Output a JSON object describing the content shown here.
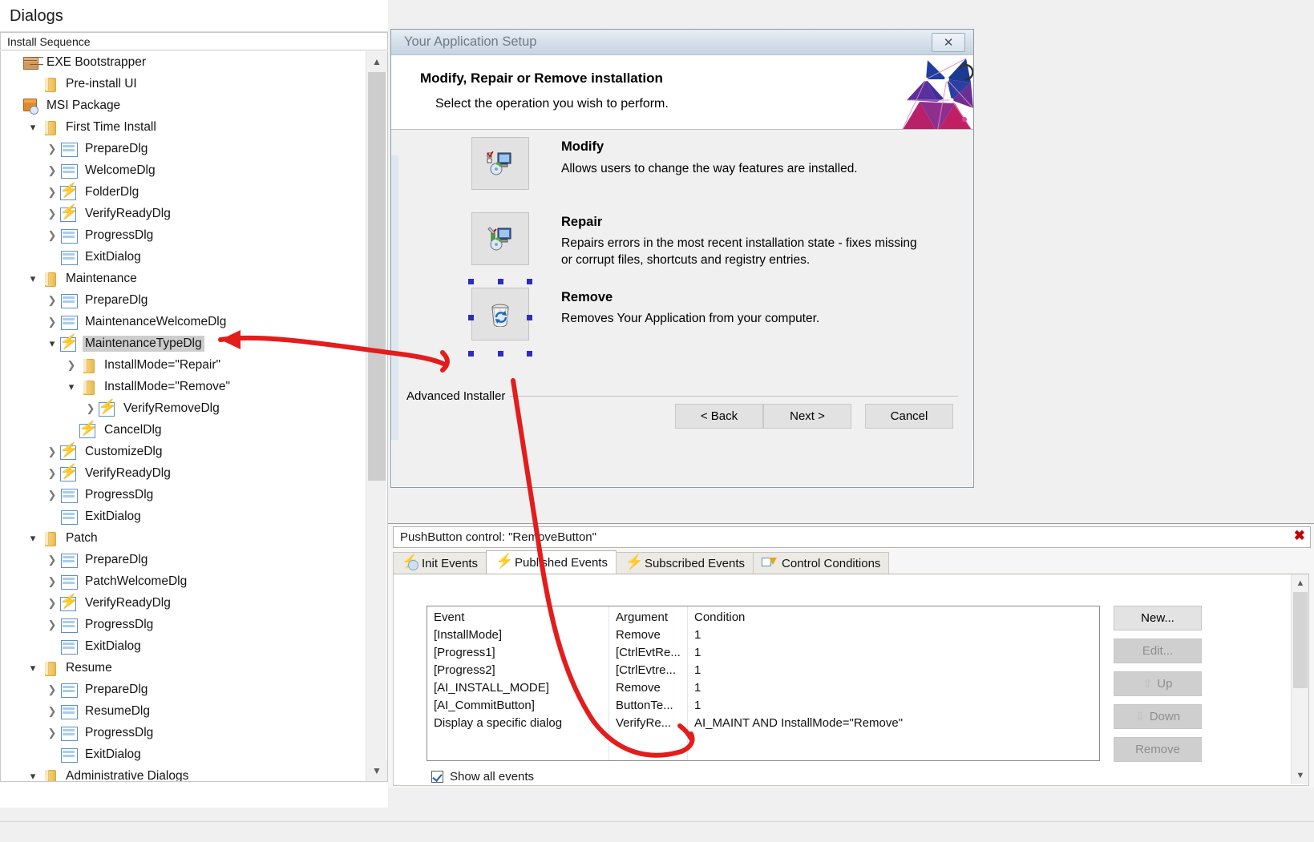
{
  "left_panel": {
    "title": "Dialogs",
    "column_header": "Install Sequence",
    "tree": [
      {
        "label": "EXE Bootstrapper",
        "indent": 0,
        "icon": "exe-package-icon",
        "chevron": "none",
        "selected": false
      },
      {
        "label": "Pre-install UI",
        "indent": 1,
        "icon": "folder-icon",
        "chevron": "none",
        "selected": false
      },
      {
        "label": "MSI Package",
        "indent": 0,
        "icon": "msi-package-icon",
        "chevron": "none",
        "selected": false
      },
      {
        "label": "First Time Install",
        "indent": 1,
        "icon": "folder-icon",
        "chevron": "down",
        "selected": false
      },
      {
        "label": "PrepareDlg",
        "indent": 2,
        "icon": "dialog-icon",
        "chevron": "right",
        "selected": false
      },
      {
        "label": "WelcomeDlg",
        "indent": 2,
        "icon": "dialog-icon",
        "chevron": "right",
        "selected": false
      },
      {
        "label": "FolderDlg",
        "indent": 2,
        "icon": "dialog-event-icon",
        "chevron": "right",
        "selected": false
      },
      {
        "label": "VerifyReadyDlg",
        "indent": 2,
        "icon": "dialog-event-icon",
        "chevron": "right",
        "selected": false
      },
      {
        "label": "ProgressDlg",
        "indent": 2,
        "icon": "dialog-icon",
        "chevron": "right",
        "selected": false
      },
      {
        "label": "ExitDialog",
        "indent": 2,
        "icon": "dialog-icon",
        "chevron": "none",
        "selected": false
      },
      {
        "label": "Maintenance",
        "indent": 1,
        "icon": "folder-icon",
        "chevron": "down",
        "selected": false
      },
      {
        "label": "PrepareDlg",
        "indent": 2,
        "icon": "dialog-icon",
        "chevron": "right",
        "selected": false
      },
      {
        "label": "MaintenanceWelcomeDlg",
        "indent": 2,
        "icon": "dialog-icon",
        "chevron": "right",
        "selected": false
      },
      {
        "label": "MaintenanceTypeDlg",
        "indent": 2,
        "icon": "dialog-event-icon",
        "chevron": "down",
        "selected": true
      },
      {
        "label": "InstallMode=\"Repair\"",
        "indent": 3,
        "icon": "folder-icon",
        "chevron": "right",
        "selected": false
      },
      {
        "label": "InstallMode=\"Remove\"",
        "indent": 3,
        "icon": "folder-icon",
        "chevron": "down",
        "selected": false
      },
      {
        "label": "VerifyRemoveDlg",
        "indent": 4,
        "icon": "dialog-event-icon",
        "chevron": "right",
        "selected": false
      },
      {
        "label": "CancelDlg",
        "indent": 3,
        "icon": "dialog-event-icon",
        "chevron": "none",
        "selected": false
      },
      {
        "label": "CustomizeDlg",
        "indent": 2,
        "icon": "dialog-event-icon",
        "chevron": "right",
        "selected": false
      },
      {
        "label": "VerifyReadyDlg",
        "indent": 2,
        "icon": "dialog-event-icon",
        "chevron": "right",
        "selected": false
      },
      {
        "label": "ProgressDlg",
        "indent": 2,
        "icon": "dialog-icon",
        "chevron": "right",
        "selected": false
      },
      {
        "label": "ExitDialog",
        "indent": 2,
        "icon": "dialog-icon",
        "chevron": "none",
        "selected": false
      },
      {
        "label": "Patch",
        "indent": 1,
        "icon": "folder-icon",
        "chevron": "down",
        "selected": false
      },
      {
        "label": "PrepareDlg",
        "indent": 2,
        "icon": "dialog-icon",
        "chevron": "right",
        "selected": false
      },
      {
        "label": "PatchWelcomeDlg",
        "indent": 2,
        "icon": "dialog-icon",
        "chevron": "right",
        "selected": false
      },
      {
        "label": "VerifyReadyDlg",
        "indent": 2,
        "icon": "dialog-event-icon",
        "chevron": "right",
        "selected": false
      },
      {
        "label": "ProgressDlg",
        "indent": 2,
        "icon": "dialog-icon",
        "chevron": "right",
        "selected": false
      },
      {
        "label": "ExitDialog",
        "indent": 2,
        "icon": "dialog-icon",
        "chevron": "none",
        "selected": false
      },
      {
        "label": "Resume",
        "indent": 1,
        "icon": "folder-icon",
        "chevron": "down",
        "selected": false
      },
      {
        "label": "PrepareDlg",
        "indent": 2,
        "icon": "dialog-icon",
        "chevron": "right",
        "selected": false
      },
      {
        "label": "ResumeDlg",
        "indent": 2,
        "icon": "dialog-icon",
        "chevron": "right",
        "selected": false
      },
      {
        "label": "ProgressDlg",
        "indent": 2,
        "icon": "dialog-icon",
        "chevron": "right",
        "selected": false
      },
      {
        "label": "ExitDialog",
        "indent": 2,
        "icon": "dialog-icon",
        "chevron": "none",
        "selected": false
      },
      {
        "label": "Administrative Dialogs",
        "indent": 1,
        "icon": "folder-icon",
        "chevron": "down",
        "selected": false
      }
    ]
  },
  "installer_preview": {
    "window_title": "Your Application Setup",
    "close_glyph": "✕",
    "banner_title": "Modify, Repair or Remove installation",
    "banner_subtitle": "Select the operation you wish to perform.",
    "options": [
      {
        "title": "Modify",
        "desc": "Allows users to change the way features are installed.",
        "icon": "modify-icon"
      },
      {
        "title": "Repair",
        "desc": "Repairs errors in the most recent installation state - fixes missing or corrupt files, shortcuts and registry entries.",
        "icon": "repair-icon"
      },
      {
        "title": "Remove",
        "desc": "Removes Your Application from your computer.",
        "icon": "remove-icon"
      }
    ],
    "brand_label": "Advanced Installer",
    "buttons": {
      "back": "< Back",
      "next": "Next >",
      "cancel": "Cancel"
    }
  },
  "events_panel": {
    "header": "PushButton control: \"RemoveButton\"",
    "close_glyph": "✖",
    "tabs": [
      {
        "label": "Init Events",
        "icon": "init-events-icon",
        "active": false
      },
      {
        "label": "Published Events",
        "icon": "published-events-icon",
        "active": true
      },
      {
        "label": "Subscribed Events",
        "icon": "subscribed-events-icon",
        "active": false
      },
      {
        "label": "Control Conditions",
        "icon": "control-conditions-icon",
        "active": false
      }
    ],
    "table": {
      "columns": [
        "Event",
        "Argument",
        "Condition"
      ],
      "rows": [
        {
          "event": "[InstallMode]",
          "argument": "Remove",
          "condition": "1"
        },
        {
          "event": "[Progress1]",
          "argument": "[CtrlEvtRe...",
          "condition": "1"
        },
        {
          "event": "[Progress2]",
          "argument": "[CtrlEvtre...",
          "condition": "1"
        },
        {
          "event": "[AI_INSTALL_MODE]",
          "argument": "Remove",
          "condition": "1"
        },
        {
          "event": "[AI_CommitButton]",
          "argument": "ButtonTe...",
          "condition": "1"
        },
        {
          "event": "Display a specific dialog",
          "argument": "VerifyRe...",
          "condition": "AI_MAINT AND InstallMode=\"Remove\""
        }
      ]
    },
    "side_buttons": [
      {
        "label": "New...",
        "enabled": true,
        "icon": ""
      },
      {
        "label": "Edit...",
        "enabled": false,
        "icon": ""
      },
      {
        "label": "Up",
        "enabled": false,
        "icon": "⇧"
      },
      {
        "label": "Down",
        "enabled": false,
        "icon": "⇩"
      },
      {
        "label": "Remove",
        "enabled": false,
        "icon": ""
      }
    ],
    "show_all_events_label": "Show all events"
  },
  "annotation": {
    "color": "#e31c1c",
    "description": "red hand-drawn arrows linking MaintenanceTypeDlg tree node to the Remove button and to the table row"
  }
}
